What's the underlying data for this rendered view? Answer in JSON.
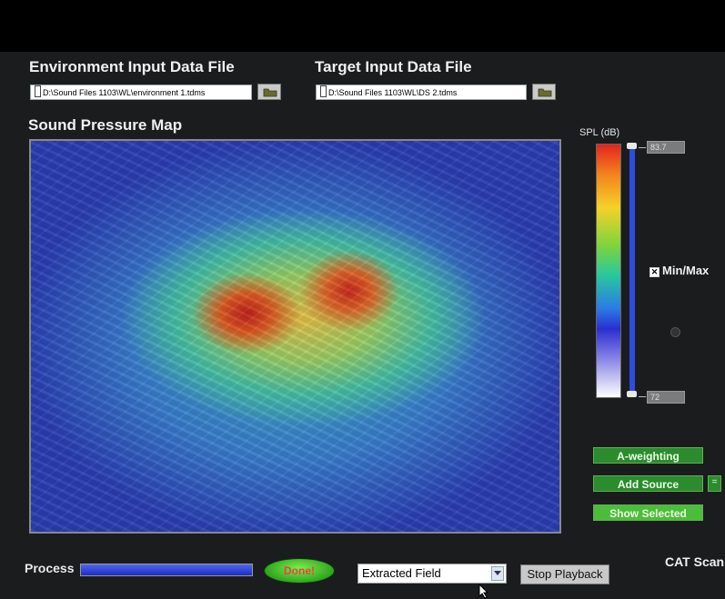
{
  "headers": {
    "environment_label": "Environment Input Data File",
    "target_label": "Target Input Data File",
    "map_title": "Sound Pressure Map"
  },
  "files": {
    "environment_path": "D:\\Sound Files 1103\\WL\\environment 1.tdms",
    "target_path": "D:\\Sound Files 1103\\WL\\DS 2.tdms"
  },
  "scale": {
    "label": "SPL (dB)",
    "max_value": "83.7",
    "min_value": "72",
    "minmax_label": "Min/Max",
    "minmax_checked": true
  },
  "buttons": {
    "a_weighting": "A-weighting",
    "add_source": "Add Source",
    "show_selected": "Show Selected"
  },
  "bottom": {
    "process_label": "Process",
    "progress": 1.0,
    "done_label": "Done!",
    "field_select": "Extracted Field",
    "stop_playback": "Stop Playback",
    "cat_scan": "CAT Scan"
  },
  "colors": {
    "button_green": "#2a8c2c",
    "progress_blue": "#2f4be0",
    "done_text": "#f04040"
  }
}
